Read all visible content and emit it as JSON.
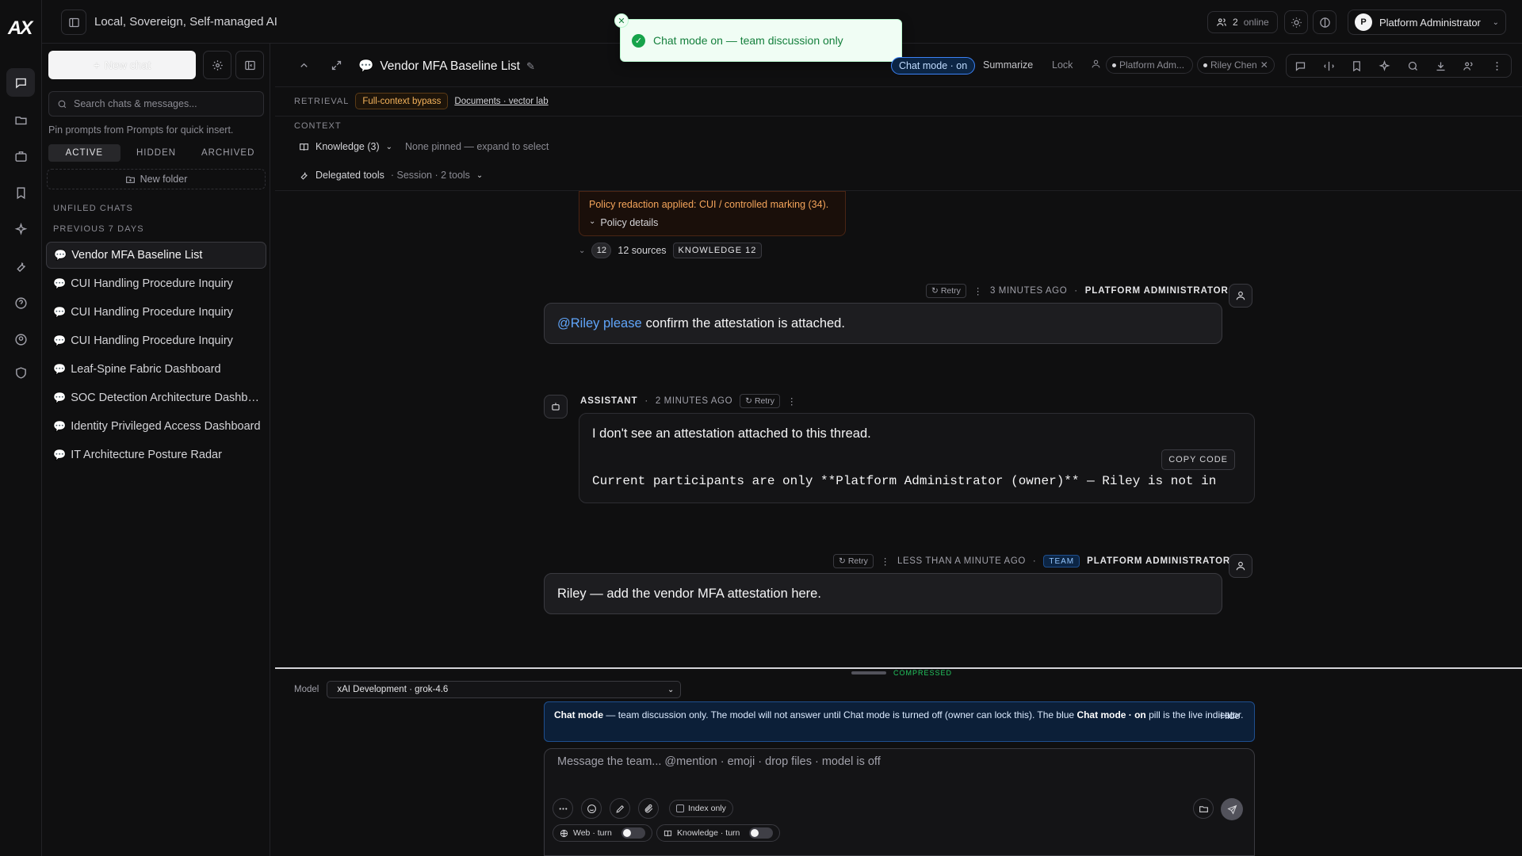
{
  "header": {
    "app_title": "Local, Sovereign, Self-managed AI",
    "online_count": "2",
    "online_label": "online",
    "user_initial": "P",
    "user_name": "Platform Administrator"
  },
  "toast": {
    "message": "Chat mode on — team discussion only"
  },
  "sidebar": {
    "new_chat_label": "New chat",
    "search_placeholder": "Search chats & messages...",
    "pin_hint": "Pin prompts from Prompts for quick insert.",
    "tabs": [
      "ACTIVE",
      "HIDDEN",
      "ARCHIVED"
    ],
    "new_folder_label": "New folder",
    "unfiled_label": "UNFILED CHATS",
    "previous_label": "PREVIOUS 7 DAYS",
    "chats": [
      "Vendor MFA Baseline List",
      "CUI Handling Procedure Inquiry",
      "CUI Handling Procedure Inquiry",
      "CUI Handling Procedure Inquiry",
      "Leaf-Spine Fabric Dashboard",
      "SOC Detection Architecture Dashboard",
      "Identity Privileged Access Dashboard",
      "IT Architecture Posture Radar"
    ]
  },
  "chat": {
    "title": "Vendor MFA Baseline List",
    "chat_mode_pill": "Chat mode · on",
    "summarize_label": "Summarize",
    "lock_label": "Lock",
    "participants": [
      "Platform Adm...",
      "Riley Chen"
    ],
    "retrieval_label": "RETRIEVAL",
    "retrieval_mode": "Full-context bypass",
    "retrieval_link": "Documents · vector lab",
    "context_label": "CONTEXT",
    "knowledge_label": "Knowledge (3)",
    "knowledge_hint": "None pinned — expand to select",
    "tools_label": "Delegated tools",
    "tools_hint": "· Session · 2 tools"
  },
  "messages": {
    "policy_text": "Policy redaction applied: CUI / controlled marking (34).",
    "policy_details": "Policy details",
    "sources_count": "12",
    "sources_label": "12 sources",
    "knowledge_badge": "KNOWLEDGE 12",
    "msg1": {
      "retry": "Retry",
      "time": "3 MINUTES AGO",
      "author": "PLATFORM ADMINISTRATOR",
      "mention": "@Riley please",
      "text": "confirm the attestation is attached."
    },
    "msg2": {
      "author": "ASSISTANT",
      "time": "2 MINUTES AGO",
      "retry": "Retry",
      "text": "I don't see an attestation attached to this thread.",
      "copy_label": "COPY CODE",
      "code": "Current participants are only **Platform Administrator (owner)** — Riley is not in"
    },
    "msg3": {
      "retry": "Retry",
      "time": "LESS THAN A MINUTE AGO",
      "team_badge": "TEAM",
      "author": "PLATFORM ADMINISTRATOR",
      "text": "Riley — add the vendor MFA attestation here."
    }
  },
  "composer": {
    "compressed_label": "COMPRESSED",
    "model_label": "Model",
    "model_value": "xAI Development · grok-4.6",
    "info_title": "Chat mode",
    "info_text1": "— team discussion only. The model will not answer until Chat mode is turned off (owner can lock this). The blue",
    "info_pill_ref": "Chat mode · on",
    "info_text2": "pill is the live indicator.",
    "hide_label": "Hide",
    "placeholder": "Message the team... @mention · emoji · drop files · model is off",
    "index_only_label": "Index only",
    "web_toggle_label": "Web · turn",
    "knowledge_toggle_label": "Knowledge · turn"
  }
}
